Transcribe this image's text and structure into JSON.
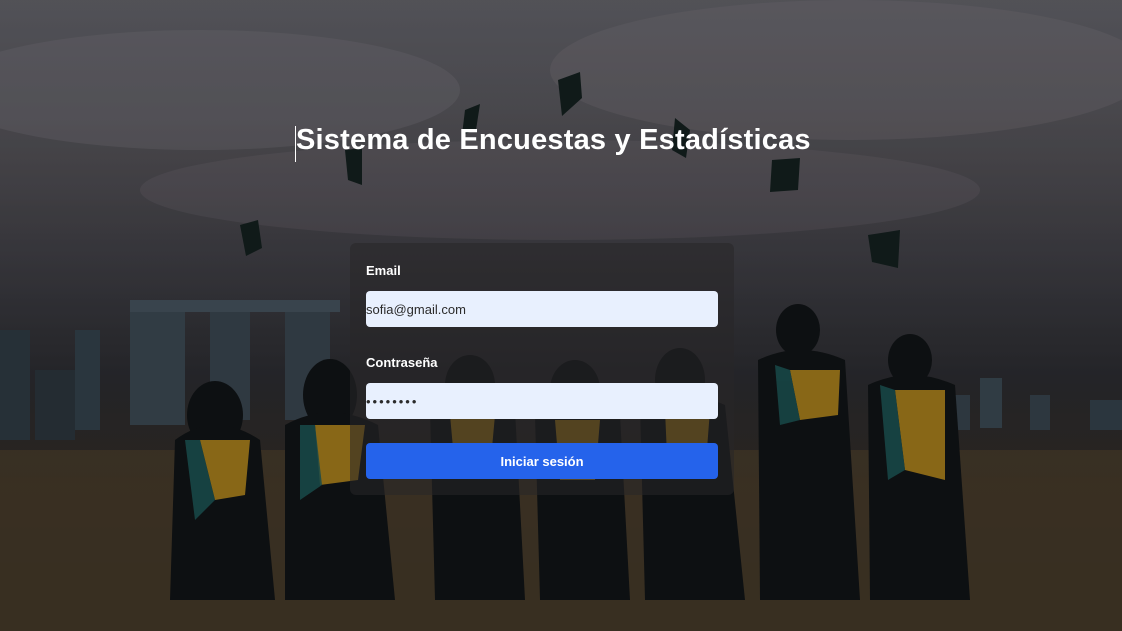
{
  "page": {
    "title": "Sistema de Encuestas y Estadísticas"
  },
  "login_form": {
    "email_label": "Email",
    "email_value": "sofia@gmail.com",
    "password_label": "Contraseña",
    "password_value": "••••••••",
    "submit_label": "Iniciar sesión"
  },
  "colors": {
    "button_bg": "#2563eb",
    "input_bg": "#e8f0fe",
    "card_overlay": "rgba(40,38,40,0.55)"
  },
  "background": {
    "description_icon": "graduation-photo"
  }
}
